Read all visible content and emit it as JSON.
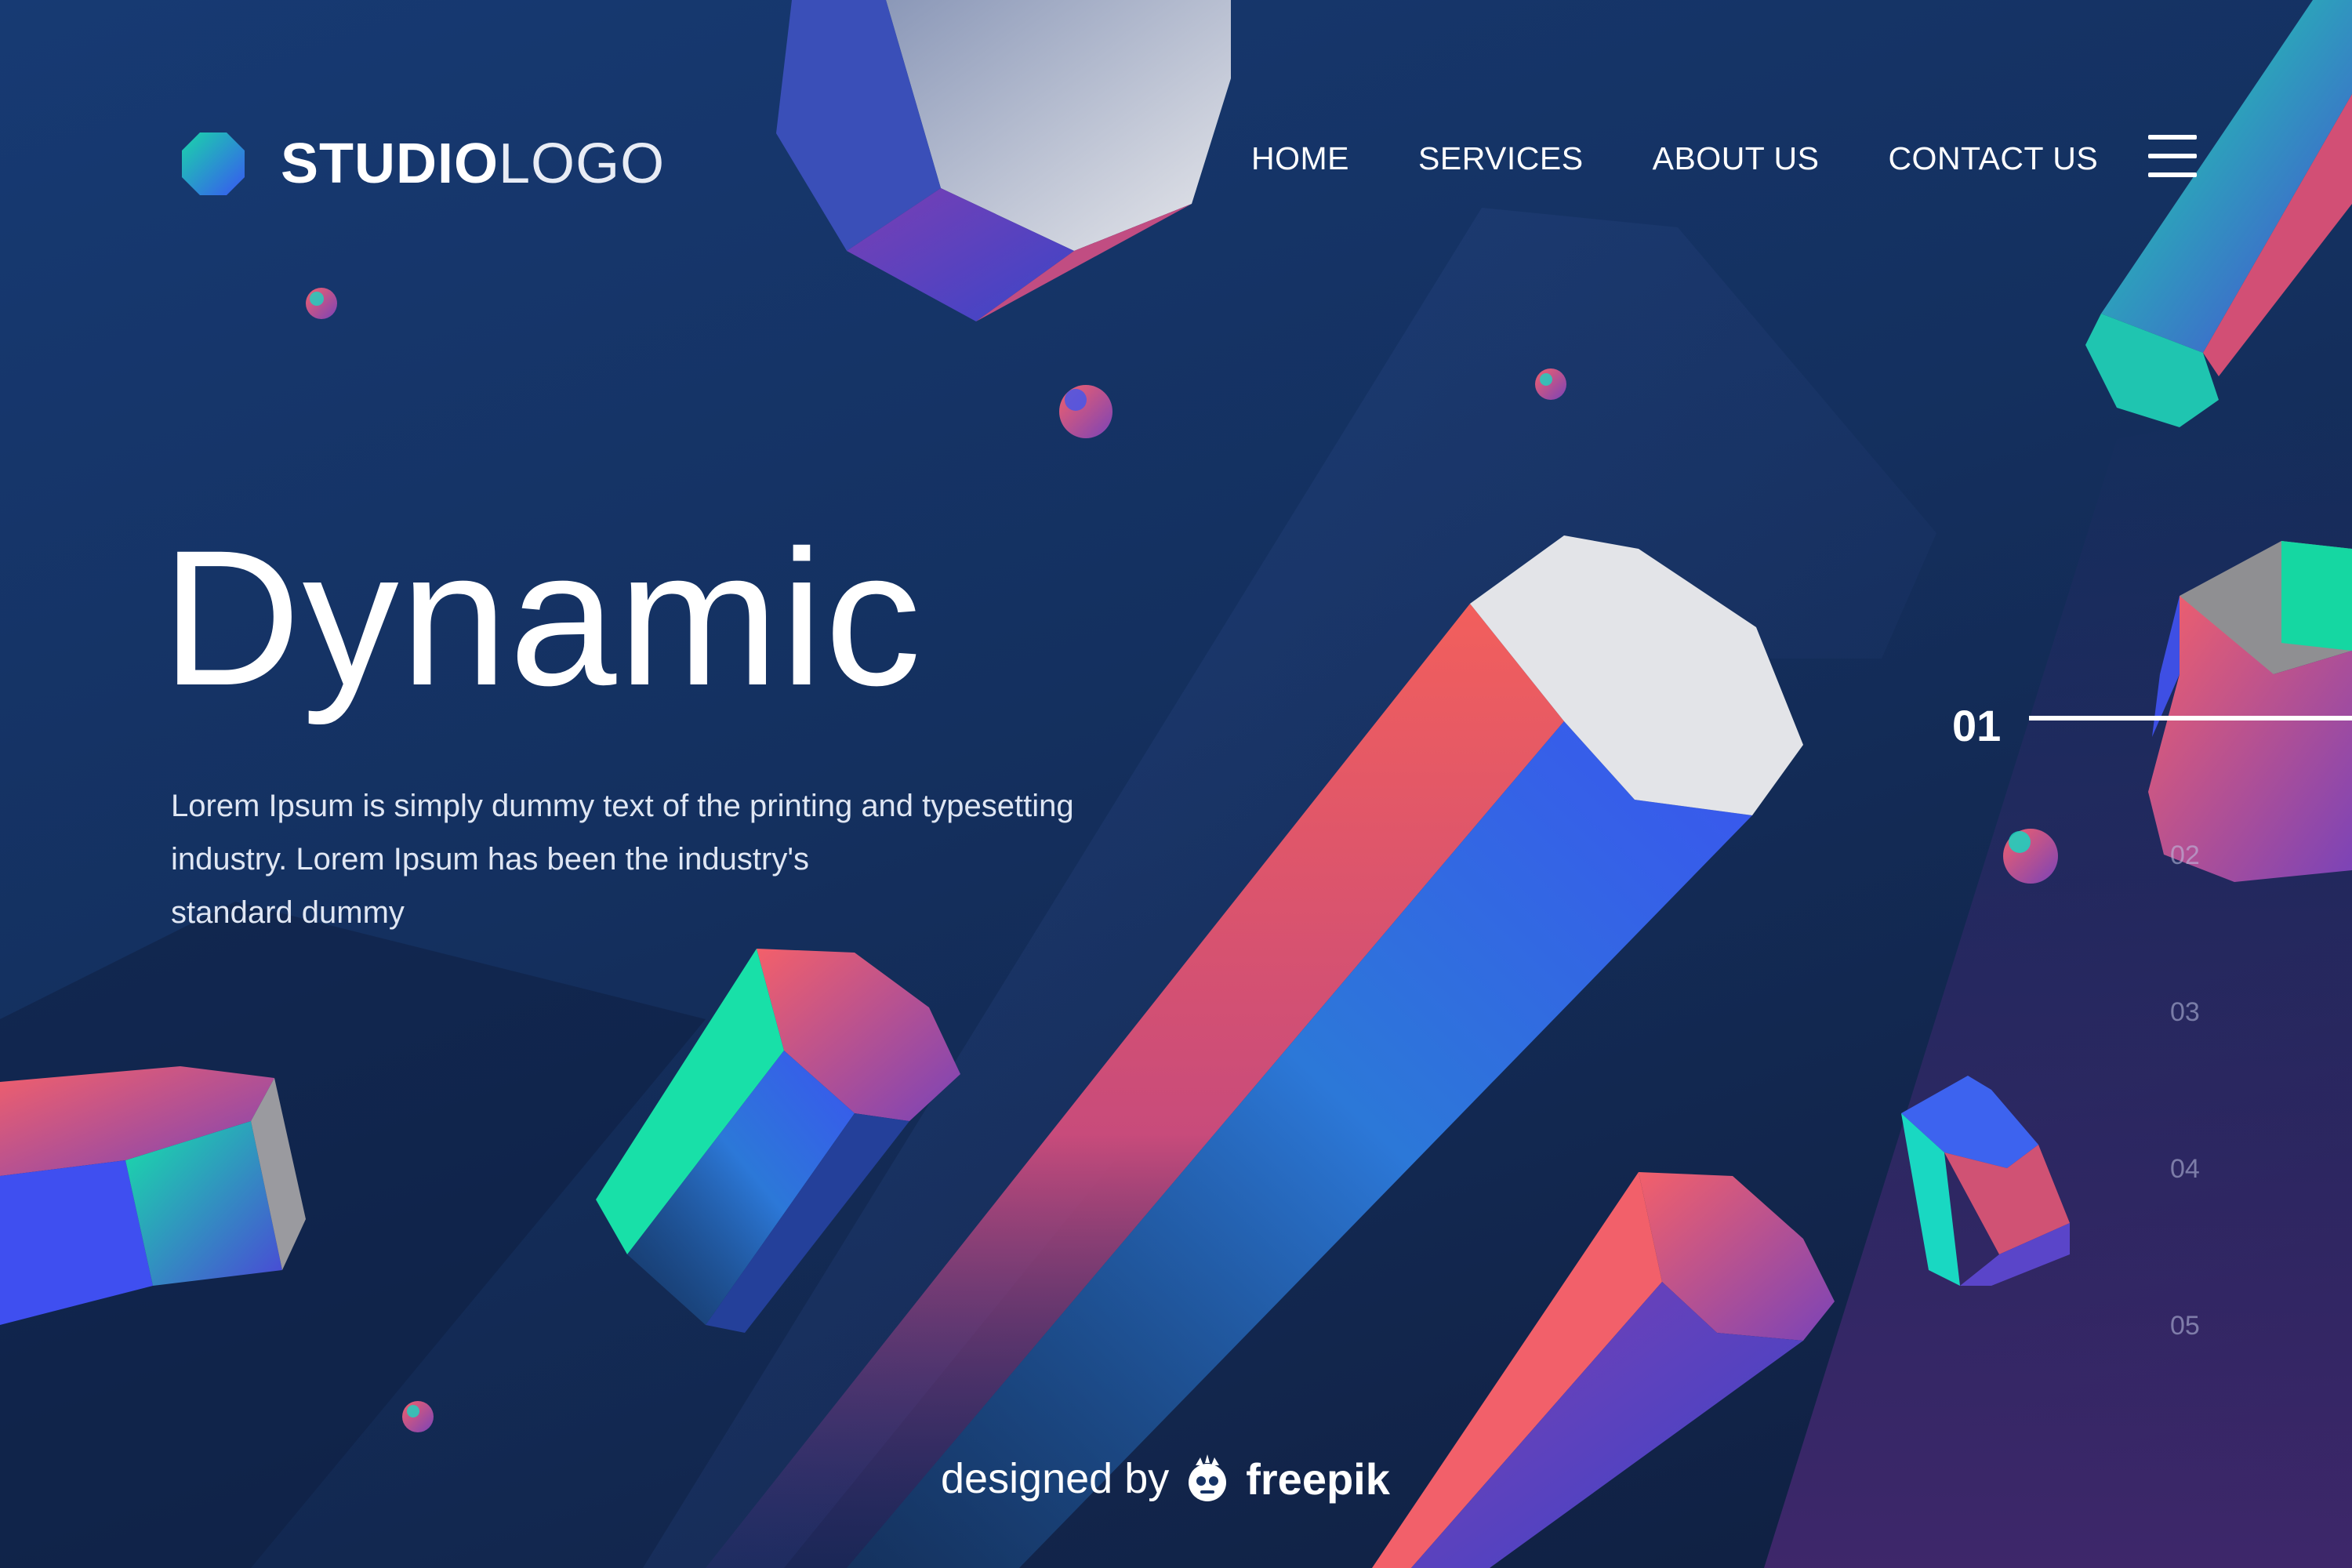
{
  "logo": {
    "bold": "STUDIO",
    "light": "LOGO",
    "icon": "octagon-logo-icon"
  },
  "nav": {
    "home": "HOME",
    "services": "SERVICES",
    "about": "ABOUT US",
    "contact": "CONTACT US",
    "menu_icon": "hamburger-menu-icon"
  },
  "hero": {
    "title": "Dynamic",
    "lines": [
      "Lorem Ipsum is simply dummy text of the printing and typesetting",
      "industry. Lorem Ipsum has been the industry's",
      "standard dummy"
    ]
  },
  "pager": {
    "active": "01",
    "items": [
      "02",
      "03",
      "04",
      "05"
    ]
  },
  "credit": {
    "prefix": "designed by",
    "brand": "freepik",
    "icon": "freepik-mascot-icon"
  },
  "colors": {
    "background": "#153468",
    "coral": "#f1585f",
    "blue": "#3b55ee",
    "teal": "#14e3a6",
    "purple": "#5b3a9e",
    "light_face": "#e3e4e8"
  }
}
